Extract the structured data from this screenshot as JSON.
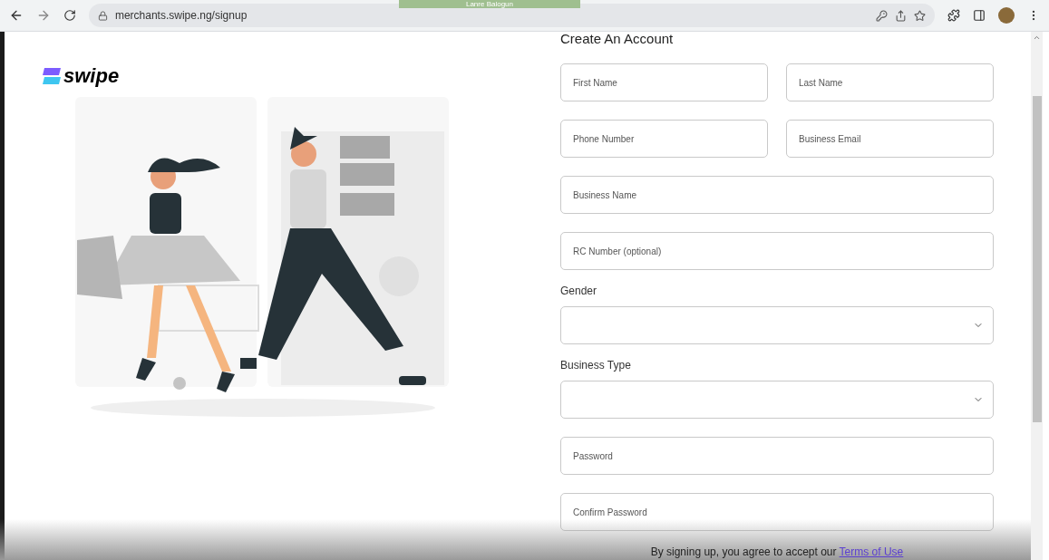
{
  "browser": {
    "tab_title": "Lanre Balogun",
    "url": "merchants.swipe.ng/signup"
  },
  "logo": {
    "text": "swipe"
  },
  "form": {
    "title": "Create An Account",
    "rows": [
      [
        {
          "kind": "input",
          "placeholder": "First Name"
        },
        {
          "kind": "input",
          "placeholder": "Last Name"
        }
      ],
      [
        {
          "kind": "input",
          "placeholder": "Phone Number"
        },
        {
          "kind": "input",
          "placeholder": "Business Email"
        }
      ],
      [
        {
          "kind": "input",
          "placeholder": "Business Name"
        }
      ],
      [
        {
          "kind": "input",
          "placeholder": "RC Number (optional)"
        }
      ],
      [
        {
          "kind": "select",
          "label": "Gender"
        }
      ],
      [
        {
          "kind": "select",
          "label": "Business Type"
        }
      ],
      [
        {
          "kind": "input",
          "placeholder": "Password"
        }
      ],
      [
        {
          "kind": "input",
          "placeholder": "Confirm Password"
        }
      ]
    ]
  },
  "footer": {
    "text": "By signing up, you agree to accept our",
    "link": "Terms of Use"
  }
}
